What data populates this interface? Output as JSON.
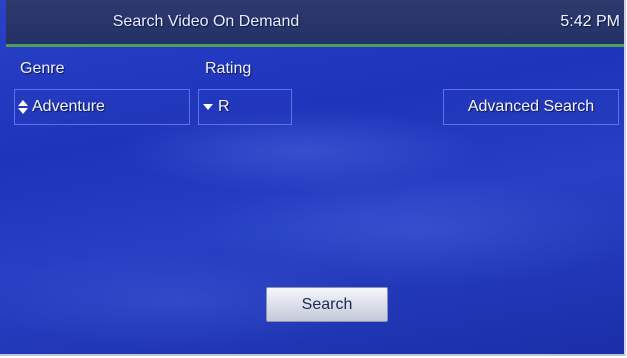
{
  "header": {
    "title": "Search Video On Demand",
    "time": "5:42 PM"
  },
  "filters": {
    "genre": {
      "label": "Genre",
      "value": "Adventure"
    },
    "rating": {
      "label": "Rating",
      "value": "R"
    }
  },
  "buttons": {
    "advanced_search": "Advanced Search",
    "search": "Search"
  },
  "colors": {
    "accent_line": "#4f9e5c",
    "background": "#2238c0",
    "topbar": "#2a3568"
  }
}
